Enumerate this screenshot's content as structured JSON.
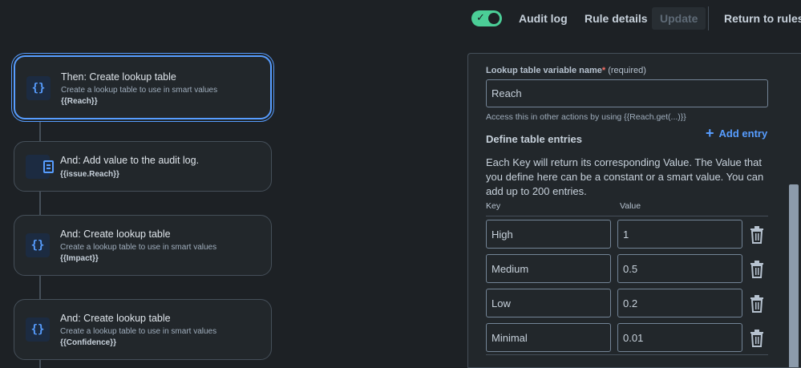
{
  "topbar": {
    "toggle_state": "on",
    "audit_log": "Audit log",
    "rule_details": "Rule details",
    "update": "Update",
    "return_to_rules": "Return to rules"
  },
  "flow": {
    "cards": [
      {
        "icon": "{}",
        "title": "Then: Create lookup table",
        "description": "Create a lookup table to use in smart values",
        "variable": "{{Reach}}"
      },
      {
        "icon": "audit-log-icon",
        "title": "And: Add value to the audit log.",
        "variable": "{{issue.Reach}}"
      },
      {
        "icon": "{}",
        "title": "And: Create lookup table",
        "description": "Create a lookup table to use in smart values",
        "variable": "{{Impact}}"
      },
      {
        "icon": "{}",
        "title": "And: Create lookup table",
        "description": "Create a lookup table to use in smart values",
        "variable": "{{Confidence}}"
      }
    ]
  },
  "panel": {
    "label": "Lookup table variable name",
    "required_star": "*",
    "required_text": "(required)",
    "variable_value": "Reach",
    "helper": "Access this in other actions by using {{Reach.get(...)}}",
    "add_entry": "Add entry",
    "section_title": "Define table entries",
    "description": "Each Key will return its corresponding Value. The Value that you define here can be a constant or a smart value. You can add up to 200 entries.",
    "col_key": "Key",
    "col_value": "Value",
    "entries": [
      {
        "key": "High",
        "value": "1"
      },
      {
        "key": "Medium",
        "value": "0.5"
      },
      {
        "key": "Low",
        "value": "0.2"
      },
      {
        "key": "Minimal",
        "value": "0.01"
      }
    ]
  },
  "colors": {
    "accent": "#579dff",
    "toggle_on": "#4bce97",
    "background": "#1d2125",
    "surface": "#22272b"
  }
}
